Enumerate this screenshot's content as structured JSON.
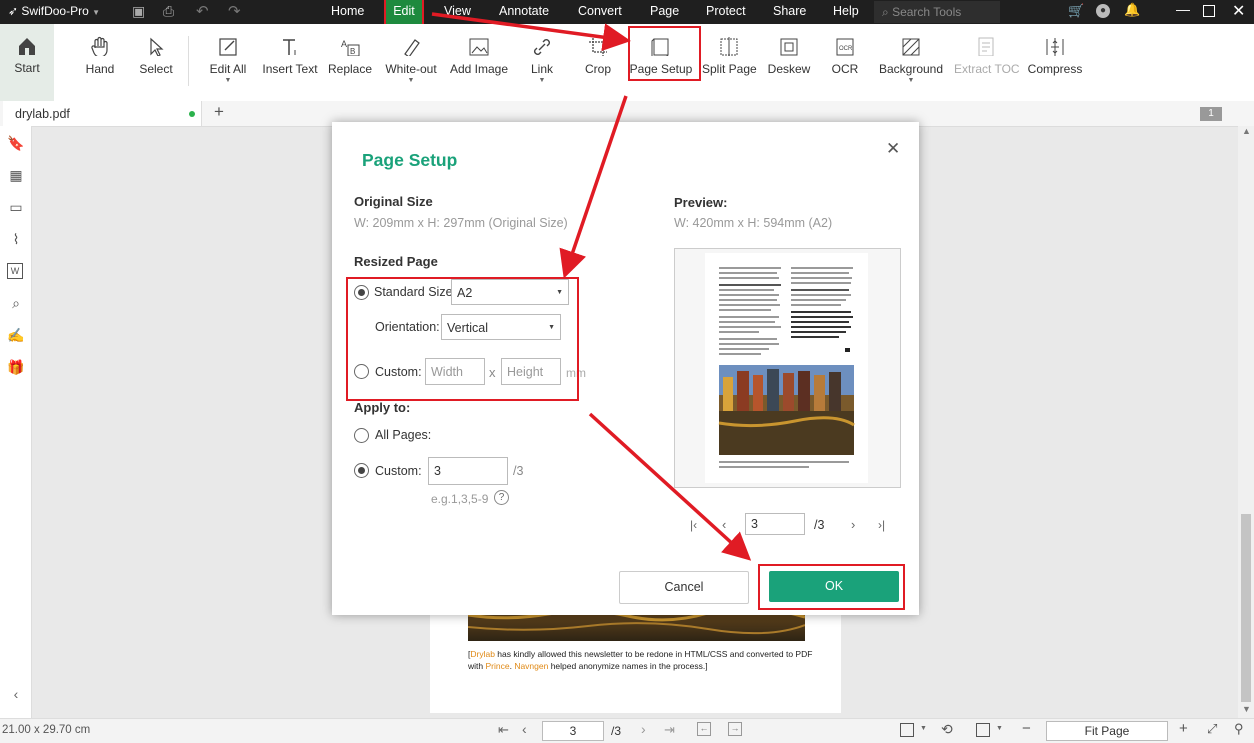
{
  "app": {
    "title": "SwifDoo-Pro"
  },
  "menu": {
    "items": [
      "Home",
      "Edit",
      "View",
      "Annotate",
      "Convert",
      "Page",
      "Protect",
      "Share",
      "Help"
    ],
    "active": "Edit",
    "search_placeholder": "Search Tools"
  },
  "ribbon": {
    "start": "Start",
    "hand": "Hand",
    "select": "Select",
    "edit_all": "Edit All",
    "insert_text": "Insert Text",
    "replace": "Replace",
    "white_out": "White-out",
    "add_image": "Add Image",
    "link": "Link",
    "crop": "Crop",
    "page_setup": "Page Setup",
    "split_page": "Split Page",
    "deskew": "Deskew",
    "ocr": "OCR",
    "background": "Background",
    "extract_toc": "Extract TOC",
    "compress": "Compress"
  },
  "tabs": {
    "file": "drylab.pdf",
    "add": "+",
    "page_badge": "1"
  },
  "dialog": {
    "title": "Page Setup",
    "original_size_heading": "Original Size",
    "original_size_value": "W: 209mm x H: 297mm (Original Size)",
    "resized_page_heading": "Resized Page",
    "standard_size_label": "Standard Size:",
    "standard_size_value": "A2",
    "orientation_label": "Orientation:",
    "orientation_value": "Vertical",
    "custom_label": "Custom:",
    "width_placeholder": "Width",
    "x_sep": "x",
    "height_placeholder": "Height",
    "mm": "mm",
    "apply_to_heading": "Apply to:",
    "all_pages": "All Pages:",
    "custom_pages_label": "Custom:",
    "custom_pages_value": "3",
    "custom_pages_total": "/3",
    "example": "e.g.1,3,5-9",
    "help": "?",
    "preview_heading": "Preview:",
    "preview_size": "W: 420mm x H: 594mm (A2)",
    "preview_page": "3",
    "preview_total": "/3",
    "cancel": "Cancel",
    "ok": "OK"
  },
  "page_content": {
    "footer_brand": "Drylab",
    "footer_text_1": " has kindly allowed this newsletter to be redone in HTML/CSS and converted to PDF",
    "footer_text_2a": "with ",
    "footer_prince": "Prince",
    "footer_sep": ". ",
    "footer_navngen": "Navngen",
    "footer_text_2b": " helped anonymize names in the process.]"
  },
  "status": {
    "size": "21.00 x 29.70 cm",
    "page": "3",
    "total": "/3",
    "zoom": "Fit Page"
  },
  "colors": {
    "accent": "#1aa27a",
    "annotation": "#e01b24",
    "titlebar": "#1f1f1f"
  }
}
